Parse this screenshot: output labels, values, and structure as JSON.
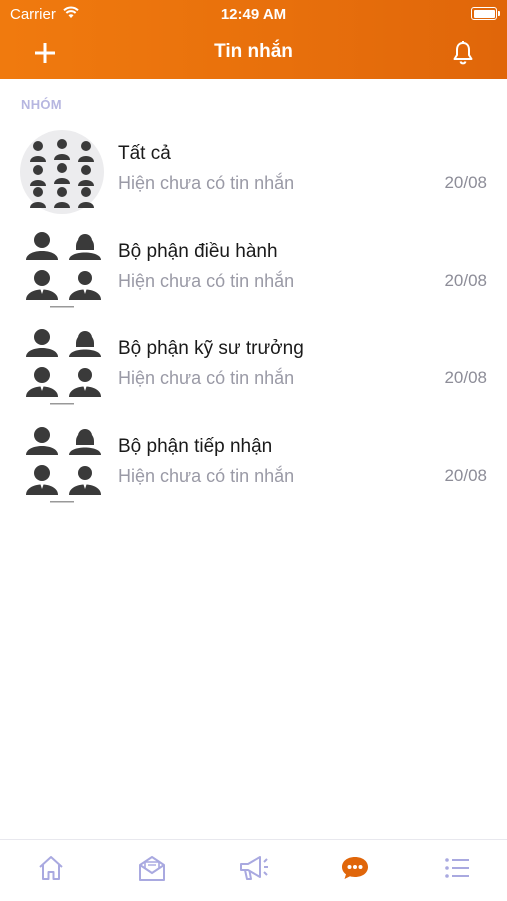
{
  "status_bar": {
    "carrier": "Carrier",
    "time": "12:49 AM"
  },
  "nav": {
    "title": "Tin nhắn"
  },
  "section_label": "NHÓM",
  "groups": [
    {
      "name": "Tất cả",
      "preview": "Hiện chưa có tin nhắn",
      "date": "20/08"
    },
    {
      "name": "Bộ phận điều hành",
      "preview": "Hiện chưa có tin nhắn",
      "date": "20/08"
    },
    {
      "name": "Bộ phận kỹ sư trưởng",
      "preview": "Hiện chưa có tin nhắn",
      "date": "20/08"
    },
    {
      "name": "Bộ phận tiếp nhận",
      "preview": "Hiện chưa có tin nhắn",
      "date": "20/08"
    }
  ],
  "tabs": [
    {
      "icon": "home-icon",
      "active": false
    },
    {
      "icon": "envelope-icon",
      "active": false
    },
    {
      "icon": "megaphone-icon",
      "active": false
    },
    {
      "icon": "chat-bubble-icon",
      "active": true
    },
    {
      "icon": "list-icon",
      "active": false
    }
  ],
  "colors": {
    "header": "#f07a0e",
    "active_tab": "#e0660a",
    "inactive_tab": "#a9a9e0",
    "section_label": "#b6b6e0"
  }
}
